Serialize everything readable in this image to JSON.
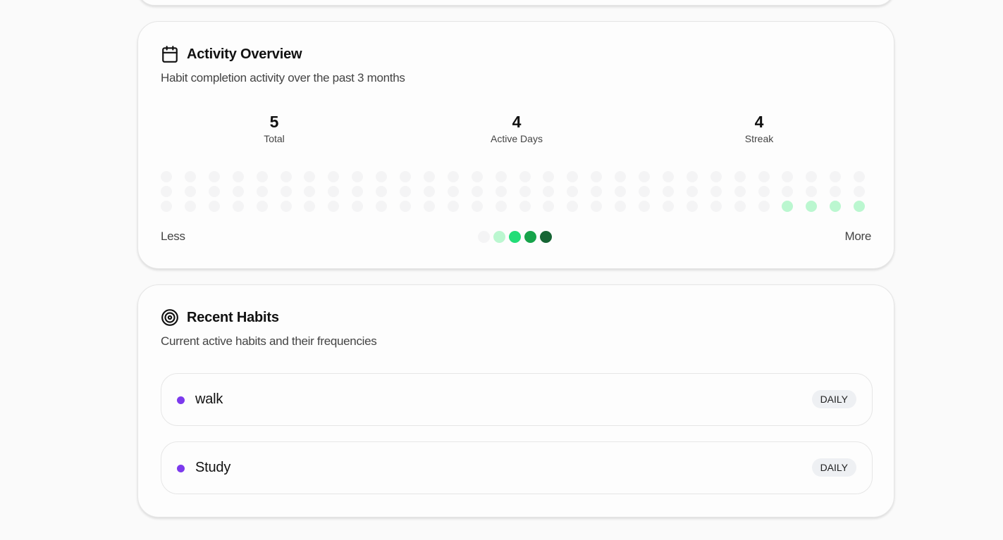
{
  "activity": {
    "title": "Activity Overview",
    "subtitle": "Habit completion activity over the past 3 months",
    "icon": "calendar-icon",
    "stats": {
      "total": {
        "value": "5",
        "label": "Total"
      },
      "active_days": {
        "value": "4",
        "label": "Active Days"
      },
      "streak": {
        "value": "4",
        "label": "Streak"
      }
    },
    "heatmap": {
      "columns": 30,
      "rows": 3,
      "levels": [
        [
          0,
          0,
          0,
          0,
          0,
          0,
          0,
          0,
          0,
          0,
          0,
          0,
          0,
          0,
          0,
          0,
          0,
          0,
          0,
          0,
          0,
          0,
          0,
          0,
          0,
          0,
          0,
          0,
          0,
          0
        ],
        [
          0,
          0,
          0,
          0,
          0,
          0,
          0,
          0,
          0,
          0,
          0,
          0,
          0,
          0,
          0,
          0,
          0,
          0,
          0,
          0,
          0,
          0,
          0,
          0,
          0,
          0,
          0,
          0,
          0,
          0
        ],
        [
          0,
          0,
          0,
          0,
          0,
          0,
          0,
          0,
          0,
          0,
          0,
          0,
          0,
          0,
          0,
          0,
          0,
          0,
          0,
          0,
          0,
          0,
          0,
          0,
          0,
          0,
          1,
          1,
          1,
          1
        ]
      ]
    },
    "legend": {
      "less": "Less",
      "more": "More",
      "colors": [
        "#f4f4f5",
        "#bbf7d0",
        "#22dd77",
        "#16a34a",
        "#166534"
      ]
    }
  },
  "habits": {
    "title": "Recent Habits",
    "subtitle": "Current active habits and their frequencies",
    "icon": "target-icon",
    "items": [
      {
        "name": "walk",
        "frequency": "DAILY",
        "color": "#7c3aed"
      },
      {
        "name": "Study",
        "frequency": "DAILY",
        "color": "#7c3aed"
      }
    ]
  }
}
